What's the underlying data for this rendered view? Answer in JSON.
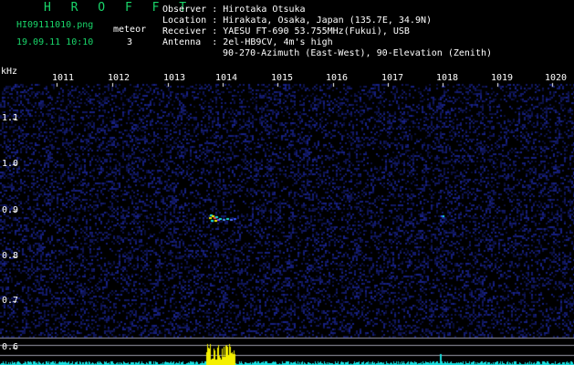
{
  "header": {
    "app_title": "H R O F F T",
    "filename": "HI09111010.png",
    "timestamp": "19.09.11 10:10",
    "meteor_label": "meteor",
    "meteor_count": "3",
    "info": [
      {
        "key": "Observer",
        "value": "Hirotaka Otsuka"
      },
      {
        "key": "Location",
        "value": "Hirakata, Osaka, Japan (135.7E, 34.9N)"
      },
      {
        "key": "Receiver",
        "value": "YAESU FT-690 53.755MHz(Fukui), USB"
      },
      {
        "key": "Antenna ",
        "value": "2el-HB9CV, 4m's high"
      }
    ],
    "antenna_line2": "90-270-Azimuth (East-West), 90-Elevation (Zenith)"
  },
  "axes": {
    "y_unit": "kHz",
    "x_ticks": [
      "1011",
      "1012",
      "1013",
      "1014",
      "1015",
      "1016",
      "1017",
      "1018",
      "1019",
      "1020"
    ],
    "y_ticks": [
      "1.1",
      "1.0",
      "0.9",
      "0.8",
      "0.7",
      "0.6"
    ]
  },
  "colors": {
    "background": "#000000",
    "noise": "#1a2a8a",
    "title_green": "#19d66a",
    "signal_yellow": "#f5f000",
    "baseline_cyan": "#19e0e0"
  }
}
